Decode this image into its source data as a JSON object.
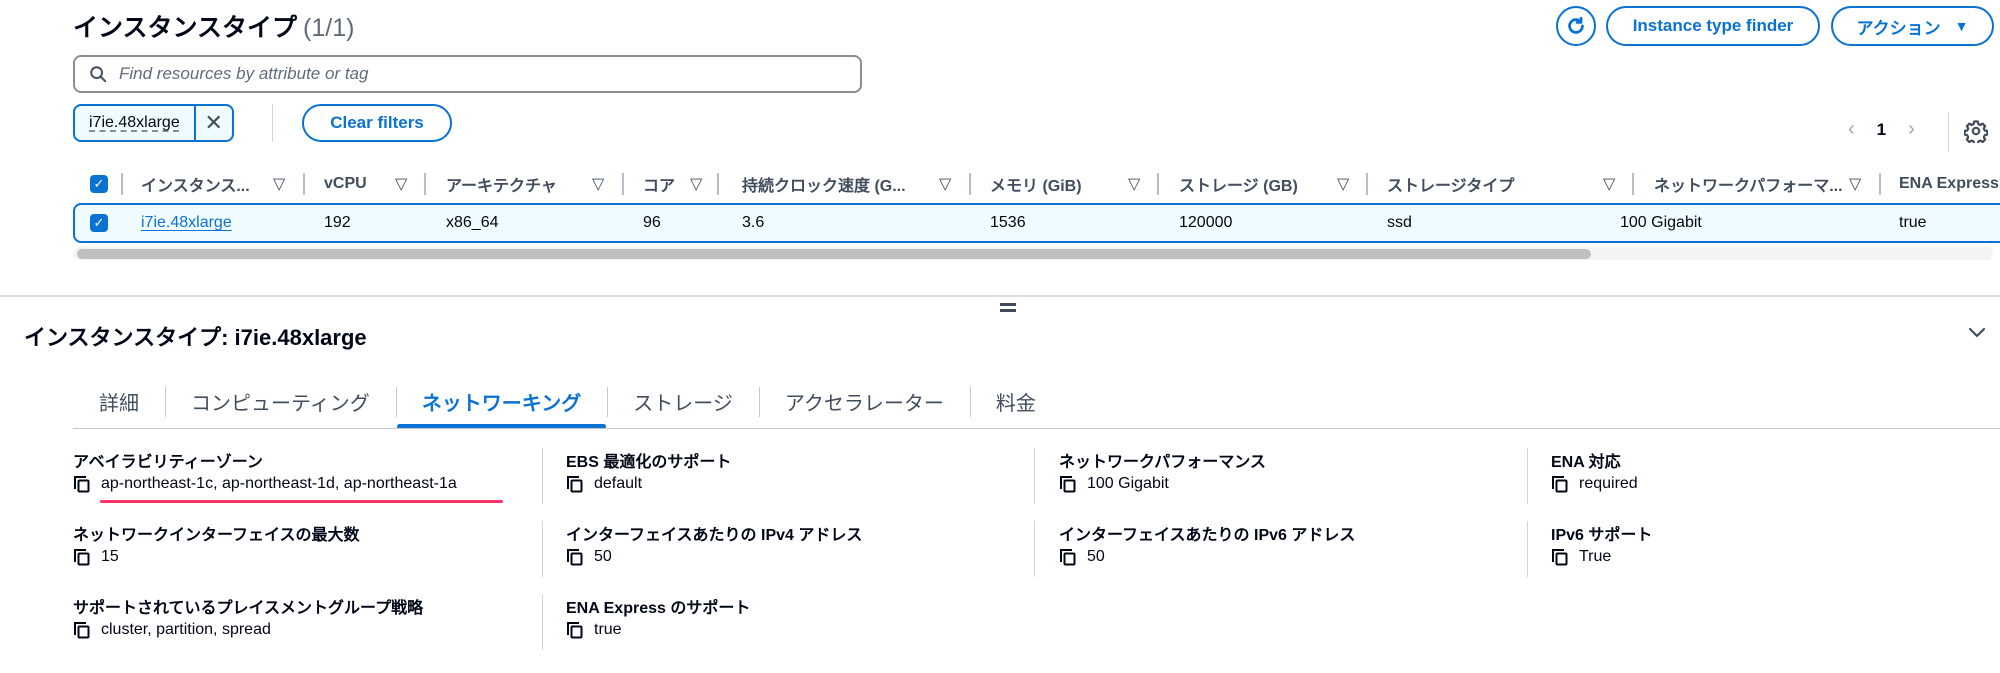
{
  "header": {
    "title": "インスタンスタイプ",
    "count": "(1/1)",
    "refresh_icon": "refresh-icon",
    "finder_label": "Instance type finder",
    "actions_label": "アクション",
    "actions_caret": "▼"
  },
  "search": {
    "placeholder": "Find resources by attribute or tag",
    "value": "",
    "icon": "search-icon"
  },
  "filter": {
    "token_label": "i7ie.48xlarge",
    "remove_glyph": "✕",
    "clear_label": "Clear filters"
  },
  "pagination": {
    "prev": "‹",
    "page": "1",
    "next": "›"
  },
  "table": {
    "sort_glyph": "▽",
    "check_glyph": "✓",
    "columns": [
      "インスタンス...",
      "vCPU",
      "アーキテクチャ",
      "コア",
      "持続クロック速度 (G...",
      "メモリ (GiB)",
      "ストレージ (GB)",
      "ストレージタイプ",
      "ネットワークパフォーマ...",
      "ENA Express"
    ],
    "rows": [
      {
        "selected": true,
        "cells": [
          "i7ie.48xlarge",
          "192",
          "x86_64",
          "96",
          "3.6",
          "1536",
          "120000",
          "ssd",
          "100 Gigabit",
          "true"
        ]
      }
    ]
  },
  "detail": {
    "title": "インスタンスタイプ: i7ie.48xlarge",
    "collapse_glyph": "⌄",
    "tabs": [
      {
        "label": "詳細",
        "active": false
      },
      {
        "label": "コンピューティング",
        "active": false
      },
      {
        "label": "ネットワーキング",
        "active": true
      },
      {
        "label": "ストレージ",
        "active": false
      },
      {
        "label": "アクセラレーター",
        "active": false
      },
      {
        "label": "料金",
        "active": false
      }
    ],
    "fields": [
      {
        "label": "アベイラビリティーゾーン",
        "value": "ap-northeast-1c, ap-northeast-1d, ap-northeast-1a"
      },
      {
        "label": "EBS 最適化のサポート",
        "value": "default"
      },
      {
        "label": "ネットワークパフォーマンス",
        "value": "100 Gigabit"
      },
      {
        "label": "ENA 対応",
        "value": "required"
      },
      {
        "label": "ネットワークインターフェイスの最大数",
        "value": "15"
      },
      {
        "label": "インターフェイスあたりの IPv4 アドレス",
        "value": "50"
      },
      {
        "label": "インターフェイスあたりの IPv6 アドレス",
        "value": "50"
      },
      {
        "label": "IPv6 サポート",
        "value": "True"
      },
      {
        "label": "サポートされているプレイスメントグループ戦略",
        "value": "cluster, partition, spread"
      },
      {
        "label": "ENA Express のサポート",
        "value": "true"
      }
    ],
    "highlight_color": "#ff3366"
  },
  "colors": {
    "accent": "#0972d3",
    "row_selected_bg": "#f0fbff",
    "text": "#000716",
    "muted": "#5f6b7a"
  }
}
